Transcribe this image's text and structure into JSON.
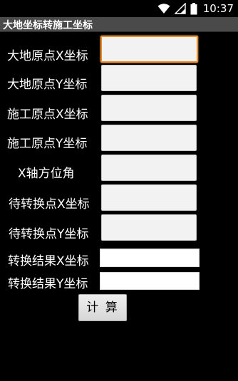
{
  "status_bar": {
    "time": "10:37",
    "icons": [
      "wifi-icon",
      "signal-icon",
      "battery-icon"
    ]
  },
  "app": {
    "title": "大地坐标转施工坐标"
  },
  "form": {
    "fields": [
      {
        "label": "大地原点X坐标",
        "value": "",
        "focused": true
      },
      {
        "label": "大地原点Y坐标",
        "value": ""
      },
      {
        "label": "施工原点X坐标",
        "value": ""
      },
      {
        "label": "施工原点Y坐标",
        "value": ""
      },
      {
        "label": "X轴方位角",
        "value": ""
      },
      {
        "label": "待转换点X坐标",
        "value": ""
      },
      {
        "label": "待转换点Y坐标",
        "value": ""
      }
    ],
    "results": [
      {
        "label": "转换结果X坐标",
        "value": ""
      },
      {
        "label": "转换结果Y坐标",
        "value": ""
      }
    ],
    "calculate_label": "计 算"
  },
  "colors": {
    "background": "#000000",
    "title_bar": "#4a4a4a",
    "input_background": "#f2f2f2",
    "focus_border": "#ef8e2c",
    "result_background": "#ffffff"
  }
}
